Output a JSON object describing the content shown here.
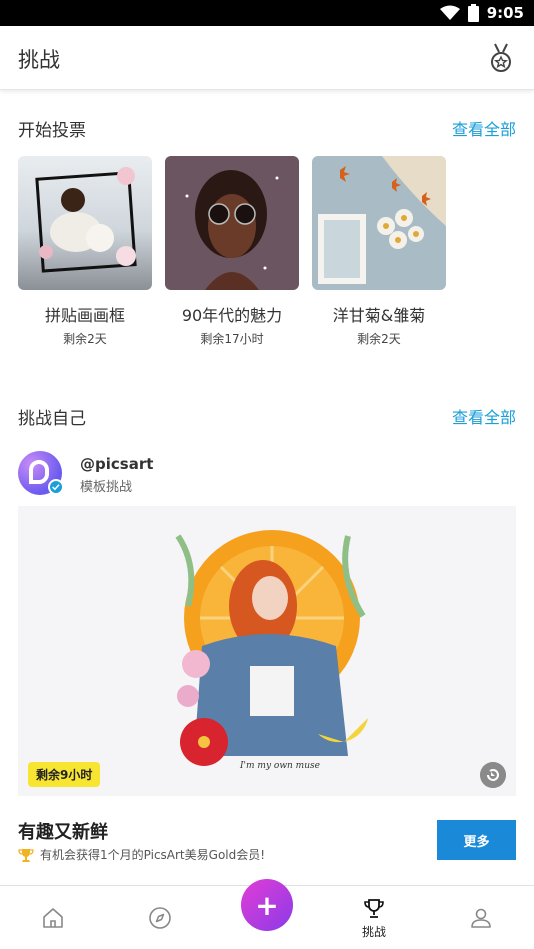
{
  "status_bar": {
    "time": "9:05"
  },
  "app_bar": {
    "title": "挑战"
  },
  "vote_section": {
    "heading": "开始投票",
    "view_all": "查看全部",
    "cards": [
      {
        "name": "拼贴画画框",
        "remaining": "剩余2天"
      },
      {
        "name": "90年代的魅力",
        "remaining": "剩余17小时"
      },
      {
        "name": "洋甘菊&雏菊",
        "remaining": "剩余2天"
      }
    ]
  },
  "self_section": {
    "heading": "挑战自己",
    "view_all": "查看全部",
    "owner": {
      "username": "@picsart",
      "label": "模板挑战"
    },
    "hero": {
      "time_left": "剩余9小时",
      "caption": "I'm my own muse"
    }
  },
  "promo": {
    "title": "有趣又新鲜",
    "subtitle": "有机会获得1个月的PicsArt美易Gold会员!",
    "button": "更多"
  },
  "bottom_nav": {
    "items": [
      {
        "icon": "home-icon"
      },
      {
        "icon": "compass-icon"
      },
      {
        "icon": "plus-icon",
        "label": "+"
      },
      {
        "icon": "trophy-icon",
        "label": "挑战"
      },
      {
        "icon": "profile-icon"
      }
    ]
  },
  "colors": {
    "accent": "#1a9fd8",
    "button": "#1a8ad8",
    "tag": "#f7e531",
    "fab_start": "#e23cd5",
    "fab_end": "#8b3be8"
  }
}
